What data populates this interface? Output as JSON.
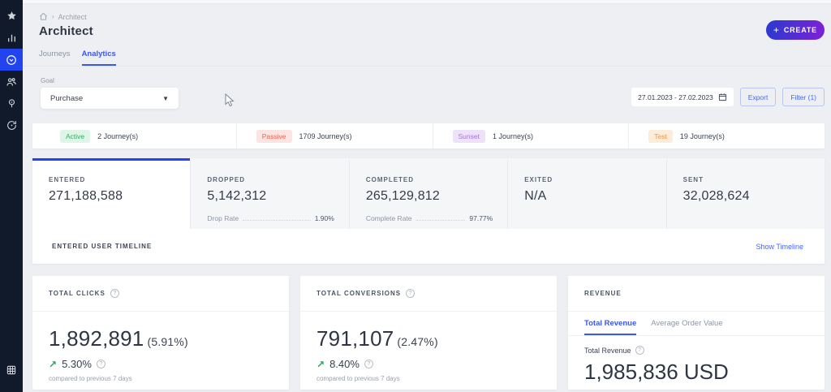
{
  "colors": {
    "accent_blue": "#3b57ee",
    "sidebar_bg": "#111a2b",
    "sidebar_active_bg": "#2244ef",
    "create_gradient": "linear-gradient(90deg,#2c39cf,#7d22d6)",
    "trend_green": "#27a35f"
  },
  "icons": {
    "sidebar": [
      "star-icon",
      "bar-chart-icon",
      "journeys-icon",
      "audience-icon",
      "idea-icon",
      "history-icon",
      "apps-icon"
    ],
    "header": [
      "home-icon",
      "chevron-right-icon",
      "plus-icon"
    ],
    "toolbar": [
      "calendar-icon",
      "chevron-down-icon"
    ],
    "cards": [
      "help-icon",
      "trend-up-arrow-icon"
    ]
  },
  "breadcrumb": {
    "item": "Architect"
  },
  "header": {
    "title": "Architect",
    "create_label": "CREATE",
    "plus": "+"
  },
  "tabs": [
    {
      "label": "Journeys",
      "active": false
    },
    {
      "label": "Analytics",
      "active": true
    }
  ],
  "goal": {
    "label": "Goal",
    "value": "Purchase",
    "caret": "▼"
  },
  "toolbar": {
    "date_range": "27.01.2023 - 27.02.2023",
    "export_label": "Export",
    "filter_label": "Filter (1)"
  },
  "journey_statuses": [
    {
      "label": "Active",
      "count": "2 Journey(s)",
      "bg": "#dff5e8",
      "color": "#2fae66"
    },
    {
      "label": "Passive",
      "count": "1709 Journey(s)",
      "bg": "#fce4e2",
      "color": "#ef6355"
    },
    {
      "label": "Sunset",
      "count": "1 Journey(s)",
      "bg": "#ede2fa",
      "color": "#a873e0"
    },
    {
      "label": "Test",
      "count": "19 Journey(s)",
      "bg": "#fcecd9",
      "color": "#e9974e"
    }
  ],
  "metrics": {
    "items": [
      {
        "label": "ENTERED",
        "value": "271,188,588"
      },
      {
        "label": "DROPPED",
        "value": "5,142,312",
        "rate_label": "Drop Rate",
        "rate": "1.90%"
      },
      {
        "label": "COMPLETED",
        "value": "265,129,812",
        "rate_label": "Complete Rate",
        "rate": "97.77%"
      },
      {
        "label": "EXITED",
        "value": "N/A"
      },
      {
        "label": "SENT",
        "value": "32,028,624"
      }
    ],
    "timeline_label": "ENTERED USER TIMELINE",
    "timeline_link": "Show Timeline"
  },
  "cards": [
    {
      "title": "TOTAL CLICKS",
      "value": "1,892,891",
      "pct": "(5.91%)",
      "trend_arrow": "↗",
      "trend": "5.30%",
      "compare": "compared to previous 7 days",
      "help": "?"
    },
    {
      "title": "TOTAL CONVERSIONS",
      "value": "791,107",
      "pct": "(2.47%)",
      "trend_arrow": "↗",
      "trend": "8.40%",
      "compare": "compared to previous 7 days",
      "help": "?"
    }
  ],
  "revenue": {
    "title": "REVENUE",
    "tabs": [
      {
        "label": "Total Revenue",
        "active": true
      },
      {
        "label": "Average Order Value",
        "active": false
      }
    ],
    "metric_label": "Total Revenue",
    "value": "1,985,836 USD",
    "help": "?"
  }
}
